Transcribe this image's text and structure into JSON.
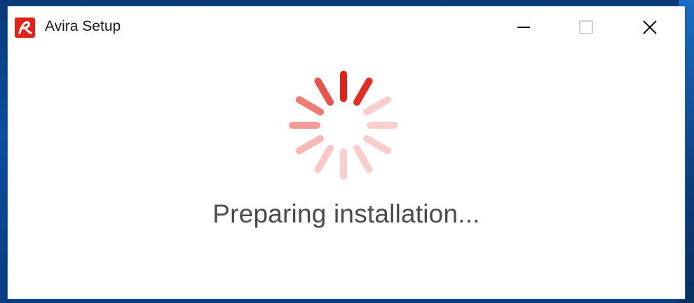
{
  "window": {
    "title": "Avira Setup"
  },
  "titlebar": {
    "minimize_icon": "minimize-icon",
    "maximize_icon": "maximize-icon",
    "close_icon": "close-icon"
  },
  "main": {
    "spinner_icon": "loading-spinner-icon",
    "status": "Preparing installation..."
  },
  "colors": {
    "brand": "#e2231a",
    "status_text": "#4a4a4a"
  }
}
